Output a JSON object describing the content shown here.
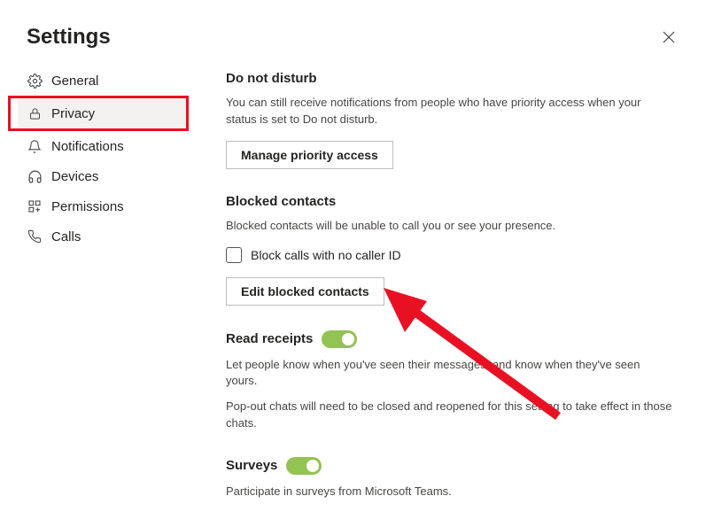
{
  "title": "Settings",
  "sidebar": {
    "items": [
      {
        "label": "General"
      },
      {
        "label": "Privacy"
      },
      {
        "label": "Notifications"
      },
      {
        "label": "Devices"
      },
      {
        "label": "Permissions"
      },
      {
        "label": "Calls"
      }
    ]
  },
  "sections": {
    "dnd": {
      "title": "Do not disturb",
      "desc": "You can still receive notifications from people who have priority access when your status is set to Do not disturb.",
      "button": "Manage priority access"
    },
    "blocked": {
      "title": "Blocked contacts",
      "desc": "Blocked contacts will be unable to call you or see your presence.",
      "checkbox": "Block calls with no caller ID",
      "button": "Edit blocked contacts"
    },
    "receipts": {
      "title": "Read receipts",
      "desc1": "Let people know when you've seen their messages, and know when they've seen yours.",
      "desc2": "Pop-out chats will need to be closed and reopened for this setting to take effect in those chats."
    },
    "surveys": {
      "title": "Surveys",
      "desc": "Participate in surveys from Microsoft Teams."
    }
  }
}
